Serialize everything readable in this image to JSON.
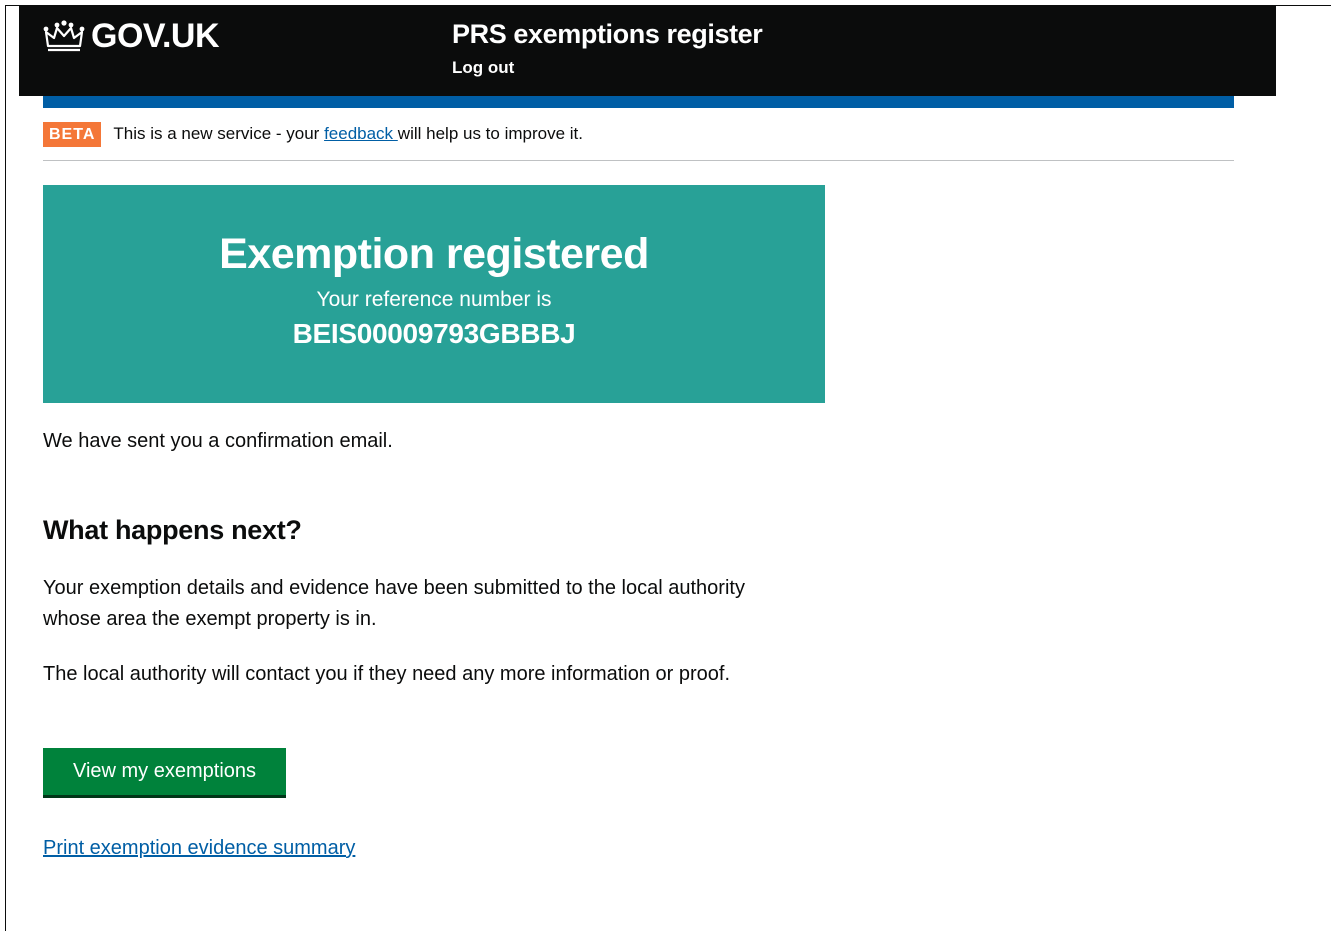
{
  "header": {
    "logo_text": "GOV.UK",
    "logo_icon": "crown-icon",
    "service_name": "PRS exemptions register",
    "logout_label": "Log out"
  },
  "beta_banner": {
    "tag": "BETA",
    "text_before": "This is a new service - your ",
    "link_text": "feedback ",
    "text_after": "will help us to improve it."
  },
  "confirmation_panel": {
    "title": "Exemption registered",
    "subtitle": "Your reference number is",
    "reference": "BEIS00009793GBBBJ"
  },
  "content": {
    "confirmation_email": "We have sent you a confirmation email.",
    "next_heading": "What happens next?",
    "details_paragraph": "Your exemption details and evidence have been submitted to the local authority whose area the exempt property is in.",
    "contact_paragraph": "The local authority will contact you if they need any more information or proof.",
    "view_button_label": "View my exemptions",
    "print_link_label": "Print exemption evidence summary"
  },
  "colors": {
    "header_bg": "#0b0c0c",
    "blue_bar": "#005ea5",
    "beta_tag": "#f47738",
    "panel_bg": "#28a197",
    "button_bg": "#00823b",
    "link": "#005ea5"
  }
}
